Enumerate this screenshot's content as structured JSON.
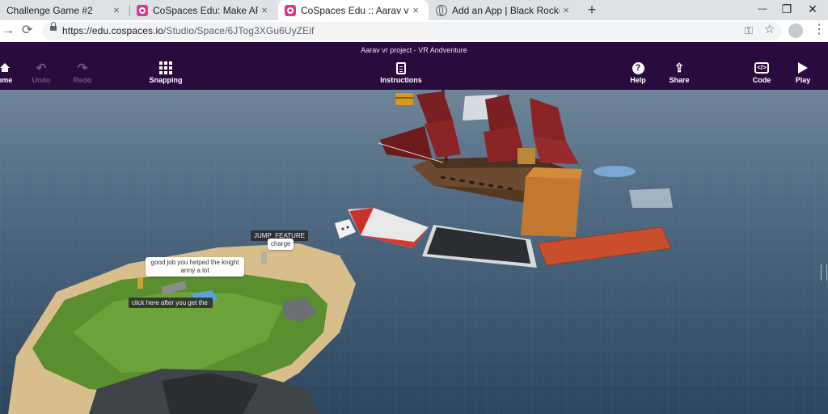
{
  "browser": {
    "tabs": [
      {
        "title": "Challenge Game #2",
        "favicon": "none",
        "active": false
      },
      {
        "title": "CoSpaces Edu: Make AR & VR in",
        "favicon": "cospaces-icon",
        "active": false
      },
      {
        "title": "CoSpaces Edu :: Aarav vr project",
        "favicon": "cospaces-icon",
        "active": true
      },
      {
        "title": "Add an App | Black Rocket Arcad",
        "favicon": "globe-icon",
        "active": false
      }
    ],
    "new_tab": "+",
    "close_glyph": "×",
    "window_controls": {
      "minimize": "—",
      "restore": "❐",
      "close": "✕"
    },
    "url_host": "https://edu.cospaces.io",
    "url_path": "/Studio/Space/6JTog3XGu6UyZEif"
  },
  "cospaces": {
    "project_title": "Aarav vr project - VR Andventure",
    "toolbar": {
      "home": "ome",
      "undo": "Undo",
      "redo": "Redo",
      "snapping": "Snapping",
      "instructions": "Instructions",
      "help": "Help",
      "share": "Share",
      "code": "Code",
      "play": "Play"
    },
    "colors": {
      "header_bg": "#2a0b3d",
      "disabled_tool": "#6c5a7c"
    }
  },
  "scene": {
    "speech_bubble": "good job you helped the knight army a lot",
    "label_jump": "JUMP_FEATURE",
    "label_charge": "charge",
    "label_click": "click here after you get the"
  }
}
